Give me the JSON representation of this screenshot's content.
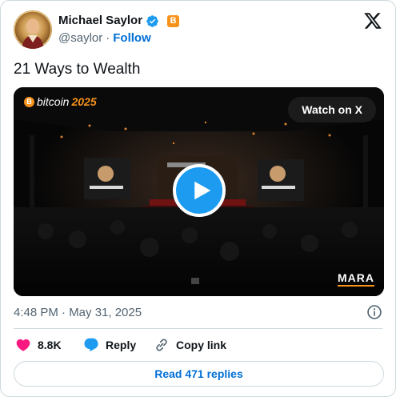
{
  "author": {
    "name": "Michael Saylor",
    "handle": "@saylor",
    "separator": "·",
    "follow_label": "Follow"
  },
  "icons": {
    "verified": "verified-badge-icon",
    "affiliate": "bitcoin-badge-icon",
    "platform": "x-logo-icon",
    "info": "info-icon",
    "like": "heart-icon",
    "reply": "speech-bubble-icon",
    "copy_link": "link-icon",
    "play": "play-icon"
  },
  "colors": {
    "accent": "#1d9bf0",
    "link": "#006fd6",
    "like": "#f91880",
    "bitcoin": "#f7931a"
  },
  "tweet": {
    "text": "21 Ways to Wealth",
    "timestamp": "4:48 PM · May 31, 2025"
  },
  "media": {
    "event_logo_prefix": "bitcoin",
    "event_logo_year": "2025",
    "watch_label": "Watch on X",
    "brand_mark": "MARA"
  },
  "actions": {
    "likes": "8.8K",
    "reply_label": "Reply",
    "copy_label": "Copy link"
  },
  "replies": {
    "label": "Read 471 replies"
  }
}
